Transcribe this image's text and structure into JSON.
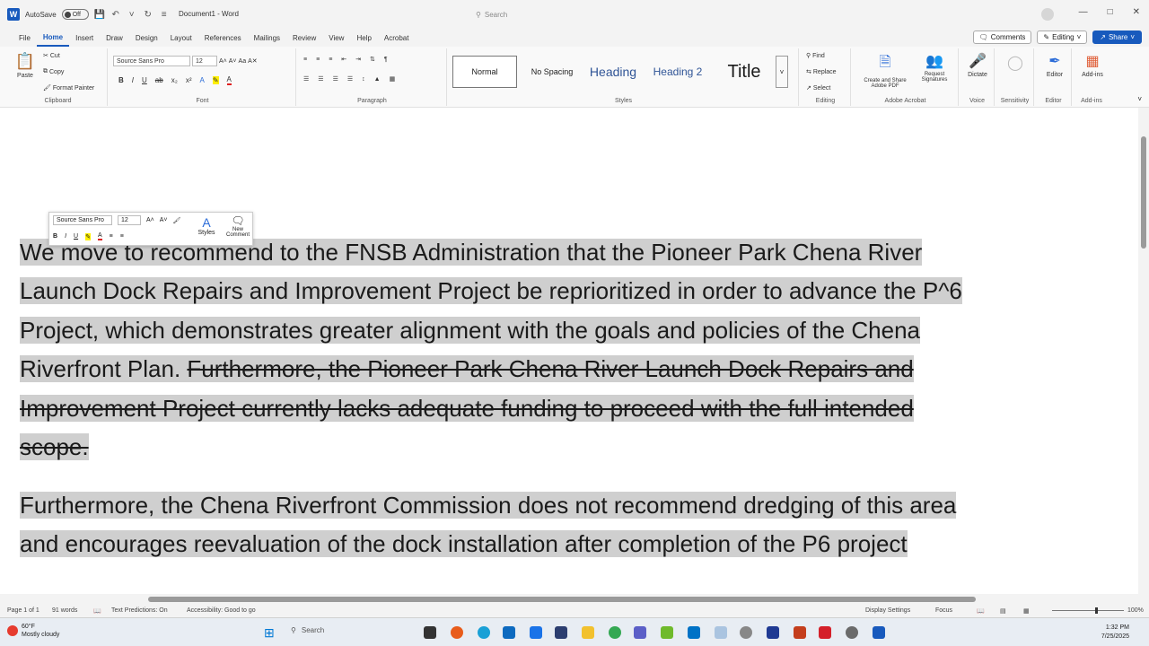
{
  "titlebar": {
    "autosave_label": "AutoSave",
    "autosave_state": "Off",
    "document_title": "Document1 - Word",
    "search_placeholder": "Search"
  },
  "menu": {
    "tabs": [
      "File",
      "Home",
      "Insert",
      "Draw",
      "Design",
      "Layout",
      "References",
      "Mailings",
      "Review",
      "View",
      "Help",
      "Acrobat"
    ],
    "active_tab": "Home",
    "comments_label": "Comments",
    "editing_label": "Editing",
    "share_label": "Share"
  },
  "ribbon": {
    "clipboard": {
      "paste": "Paste",
      "cut": "Cut",
      "copy": "Copy",
      "format_painter": "Format Painter",
      "label": "Clipboard"
    },
    "font": {
      "family": "Source Sans Pro",
      "size": "12",
      "label": "Font"
    },
    "paragraph": {
      "label": "Paragraph"
    },
    "styles": {
      "normal": "Normal",
      "no_spacing": "No Spacing",
      "heading": "Heading",
      "heading2": "Heading 2",
      "title": "Title",
      "label": "Styles"
    },
    "editing": {
      "find": "Find",
      "replace": "Replace",
      "select": "Select",
      "label": "Editing"
    },
    "adobe": {
      "create_share": "Create and Share Adobe PDF",
      "request_sig": "Request Signatures",
      "label": "Adobe Acrobat"
    },
    "voice": {
      "dictate": "Dictate",
      "label": "Voice"
    },
    "sensitivity": {
      "label": "Sensitivity"
    },
    "editor": {
      "btn": "Editor",
      "label": "Editor"
    },
    "addins": {
      "btn": "Add-ins",
      "label": "Add-ins"
    }
  },
  "float_toolbar": {
    "font": "Source Sans Pro",
    "size": "12",
    "styles": "Styles",
    "new_comment": "New Comment"
  },
  "document": {
    "p1_lines": [
      "We move to recommend to the FNSB Administration that the Pioneer Park Chena River",
      "Launch Dock Repairs and Improvement Project be reprioritized in order to advance the P^6",
      "Project, which demonstrates greater alignment with the goals and policies of the Chena"
    ],
    "p1_line4_normal": "Riverfront Plan. ",
    "p1_line4_strike": "Furthermore, the Pioneer Park Chena River Launch Dock Repairs and",
    "p1_line5_strike": "Improvement Project currently lacks adequate funding to proceed with the full intended",
    "p1_line6_strike": "scope.",
    "p2_lines": [
      "Furthermore, the Chena Riverfront Commission does not recommend dredging of this area",
      "and encourages reevaluation of the dock installation after completion of the P6 project"
    ]
  },
  "status": {
    "page": "Page 1 of 1",
    "words": "91 words",
    "text_predictions": "Text Predictions: On",
    "accessibility": "Accessibility: Good to go",
    "display_settings": "Display Settings",
    "focus": "Focus",
    "zoom": "100%"
  },
  "taskbar": {
    "weather_temp": "60°F",
    "weather_desc": "Mostly cloudy",
    "search": "Search",
    "time": "1:32 PM",
    "date": "7/25/2025"
  }
}
